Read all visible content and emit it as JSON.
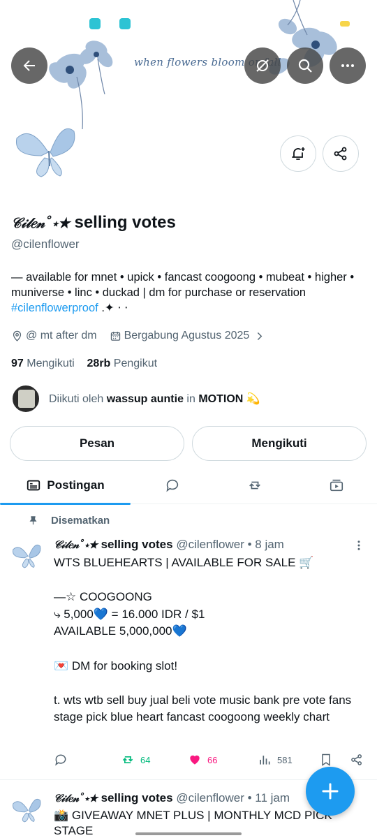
{
  "banner": {
    "text": "when flowers bloom or fall"
  },
  "nav": {
    "back_icon": "arrow-left-icon",
    "grok_icon": "grok-slash-icon",
    "search_icon": "search-icon",
    "more_icon": "more-horizontal-icon"
  },
  "profile": {
    "display_name_fancy": "𝒞𝒾𝓁𝑒𝓃˚⋆★",
    "display_name_rest": "selling votes",
    "handle": "@cilenflower",
    "bio_line": "— available for mnet • upick • fancast coogoong • mubeat • higher • muniverse • linc • duckad | dm for purchase or reservation",
    "bio_hashtag": "#cilenflowerproof",
    "bio_tail": ".✦ ⋅ ⋅",
    "location": "@ mt after dm",
    "joined": "Bergabung Agustus 2025",
    "following_count": "97",
    "following_label": "Mengikuti",
    "followers_count": "28rb",
    "followers_label": "Pengikut",
    "followed_by_prefix": "Diikuti oleh",
    "followed_by_name1": "wassup auntie",
    "followed_by_mid": "in",
    "followed_by_name2": "MOTION 💫"
  },
  "buttons": {
    "message": "Pesan",
    "following": "Mengikuti"
  },
  "tabs": {
    "posts": "Postingan"
  },
  "tweet1": {
    "pinned_label": "Disematkan",
    "name_fancy": "𝒞𝒾𝓁𝑒𝓃˚⋆★",
    "name_rest": "selling votes",
    "handle_time": "@cilenflower • 8 jam",
    "body": "WTS BLUEHEARTS | AVAILABLE FOR SALE 🛒\n\n—☆ COOGOONG\n⤷ 5,000💙 = 16.000 IDR / $1\nAVAILABLE 5,000,000💙\n\n💌 DM for booking slot!\n\nt. wts wtb sell buy jual beli vote music bank pre vote fans stage pick blue heart fancast coogoong weekly chart",
    "retweets": "64",
    "likes": "66",
    "views": "581"
  },
  "tweet2": {
    "name_fancy": "𝒞𝒾𝓁𝑒𝓃˚⋆★",
    "name_rest": "selling votes",
    "handle_time": "@cilenflower • 11 jam",
    "body": "📸 GIVEAWAY MNET PLUS | MONTHLY MCD PICK\nSTAGE"
  },
  "colors": {
    "accent": "#1d9bf0",
    "retweet": "#00ba7c",
    "like": "#f91880",
    "secondary_text": "#536471"
  }
}
